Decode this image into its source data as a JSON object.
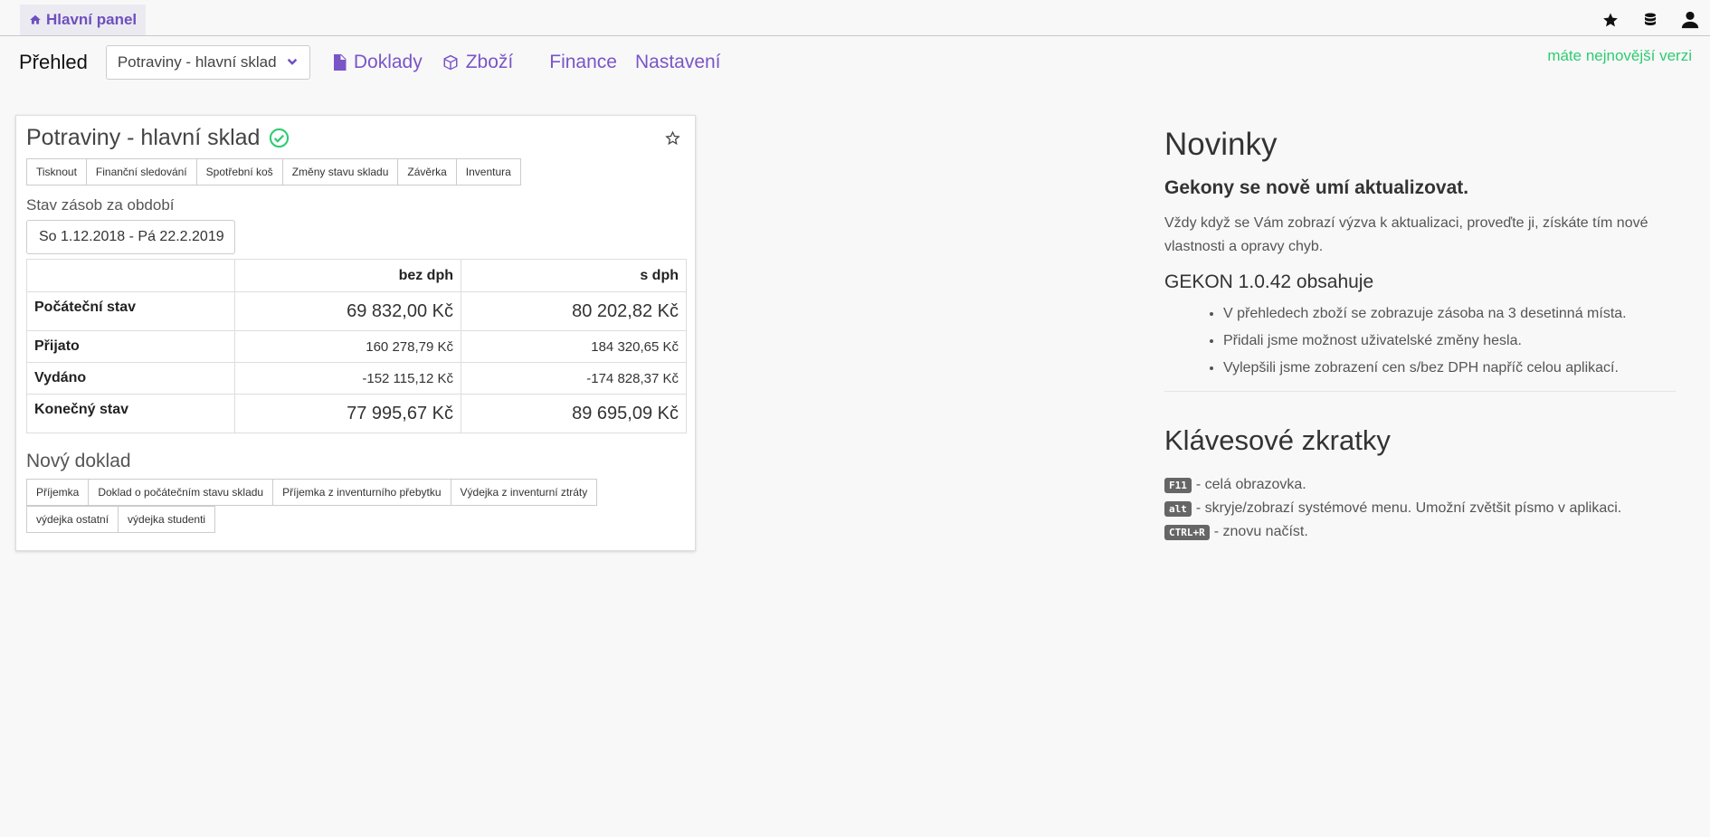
{
  "tabs": {
    "home_label": "Hlavní panel"
  },
  "topbar": {
    "icons": [
      "star-icon",
      "database-icon",
      "user-icon"
    ]
  },
  "nav": {
    "title": "Přehled",
    "warehouse_select": "Potraviny - hlavní sklad",
    "links": [
      {
        "label": "Doklady",
        "icon": "document-icon"
      },
      {
        "label": "Zboží",
        "icon": "box-icon"
      },
      {
        "label": "Finance"
      },
      {
        "label": "Nastavení"
      }
    ],
    "version_note": "máte nejnovější verzi"
  },
  "warehouse": {
    "title": "Potraviny - hlavní sklad",
    "actions": [
      "Tisknout",
      "Finanční sledování",
      "Spotřební koš",
      "Změny stavu skladu",
      "Závěrka",
      "Inventura"
    ],
    "period_label": "Stav zásob za období",
    "period_value": "So 1.12.2018  -  Pá 22.2.2019",
    "table": {
      "headers": [
        "",
        "bez dph",
        "s dph"
      ],
      "rows": [
        {
          "label": "Počáteční stav",
          "net": "69 832,00 Kč",
          "gross": "80 202,82 Kč"
        },
        {
          "label": "Přijato",
          "net": "160 278,79 Kč",
          "gross": "184 320,65 Kč"
        },
        {
          "label": "Vydáno",
          "net": "-152 115,12 Kč",
          "gross": "-174 828,37 Kč"
        },
        {
          "label": "Konečný stav",
          "net": "77 995,67 Kč",
          "gross": "89 695,09 Kč"
        }
      ]
    },
    "new_doc_label": "Nový doklad",
    "new_docs": [
      "Příjemka",
      "Doklad o počátečním stavu skladu",
      "Příjemka z inventurního přebytku",
      "Výdejka z inventurní ztráty",
      "výdejka ostatní",
      "výdejka studenti"
    ]
  },
  "news": {
    "heading": "Novinky",
    "subheading": "Gekony se nově umí aktualizovat.",
    "paragraph": "Vždy když se Vám zobrazí výzva k aktualizaci, proveďte ji, získáte tím nové vlastnosti a opravy chyb.",
    "version_heading": "GEKON 1.0.42 obsahuje",
    "items": [
      "V přehledech zboží se zobrazuje zásoba na 3 desetinná místa.",
      "Přidali jsme možnost uživatelské změny hesla.",
      "Vylepšili jsme zobrazení cen s/bez DPH napříč celou aplikací."
    ]
  },
  "shortcuts": {
    "heading": "Klávesové zkratky",
    "items": [
      {
        "key": "F11",
        "desc": "- celá obrazovka."
      },
      {
        "key": "alt",
        "desc": "- skryje/zobrazí systémové menu. Umožní zvětšit písmo v aplikaci."
      },
      {
        "key": "CTRL+R",
        "desc": "- znovu načíst."
      }
    ]
  },
  "colors": {
    "accent": "#7a55c8",
    "success": "#2ecc71"
  }
}
